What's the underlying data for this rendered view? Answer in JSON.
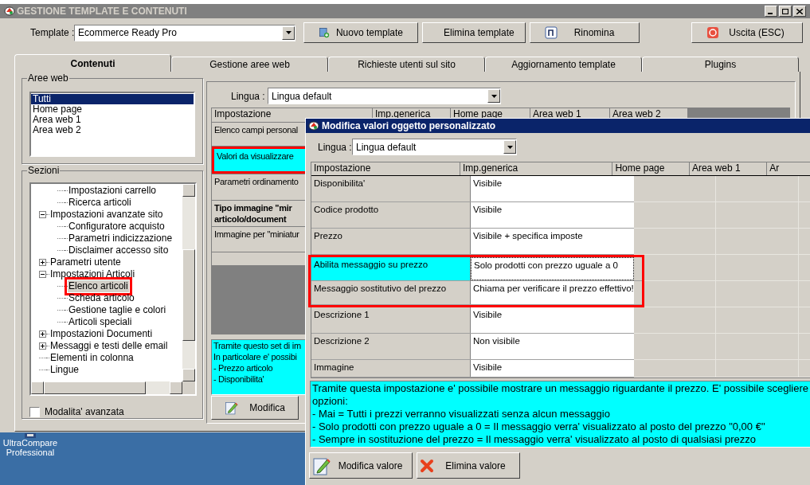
{
  "window": {
    "title": "GESTIONE TEMPLATE E CONTENUTI"
  },
  "template": {
    "label": "Template :",
    "value": "Ecommerce Ready Pro"
  },
  "toolbar": [
    {
      "kind": "new",
      "label": "Nuovo template"
    },
    {
      "kind": "delete",
      "label": "Elimina template"
    },
    {
      "kind": "rename",
      "label": "Rinomina"
    },
    {
      "kind": "exit",
      "label": "Uscita (ESC)"
    }
  ],
  "tabs": [
    {
      "label": "Contenuti",
      "selected": true
    },
    {
      "label": "Gestione aree web",
      "selected": false
    },
    {
      "label": "Richieste utenti sul sito",
      "selected": false
    },
    {
      "label": "Aggiornamento template",
      "selected": false
    },
    {
      "label": "Plugins",
      "selected": false
    }
  ],
  "aree_web": {
    "title": "Aree web",
    "items": [
      {
        "label": "Tutti",
        "selected": true
      },
      {
        "label": "Home page",
        "selected": false
      },
      {
        "label": "Area web 1",
        "selected": false
      },
      {
        "label": "Area web 2",
        "selected": false
      }
    ]
  },
  "sezioni": {
    "title": "Sezioni",
    "orphan_items": [
      {
        "label": "Impostazioni carrello",
        "selected": false,
        "highlighted": false
      },
      {
        "label": "Ricerca articoli",
        "selected": false,
        "highlighted": false
      }
    ],
    "items": [
      {
        "label": "Impostazioni avanzate sito",
        "expanded": true,
        "selected": false,
        "highlighted": false,
        "children": [
          {
            "label": "Configuratore acquisto",
            "selected": false,
            "highlighted": false
          },
          {
            "label": "Parametri indicizzazione",
            "selected": false,
            "highlighted": false
          },
          {
            "label": "Disclaimer accesso sito",
            "selected": false,
            "highlighted": false
          }
        ]
      },
      {
        "label": "Parametri utente",
        "expanded": false,
        "selected": false,
        "highlighted": false
      },
      {
        "label": "Impostazioni Articoli",
        "expanded": true,
        "selected": false,
        "highlighted": false,
        "children": [
          {
            "label": "Elenco articoli",
            "selected": true,
            "highlighted": true
          },
          {
            "label": "Scheda articolo",
            "selected": false,
            "highlighted": false
          },
          {
            "label": "Gestione taglie e colori",
            "selected": false,
            "highlighted": false
          },
          {
            "label": "Articoli speciali",
            "selected": false,
            "highlighted": false
          }
        ]
      },
      {
        "label": "Impostazioni Documenti",
        "expanded": false,
        "selected": false,
        "highlighted": false
      },
      {
        "label": "Messaggi e testi delle email",
        "expanded": false,
        "selected": false,
        "highlighted": false
      },
      {
        "label": "Elementi in colonna",
        "selected": false,
        "highlighted": false
      },
      {
        "label": "Lingue",
        "selected": false,
        "highlighted": false
      }
    ]
  },
  "advanced": {
    "label": "Modalita' avanzata",
    "checked": false
  },
  "content": {
    "language": {
      "label": "Lingua :",
      "value": "Lingua default"
    },
    "columns": [
      "Impostazione",
      "Imp.generica",
      "Home page",
      "Area web 1",
      "Area web 2"
    ],
    "rows": [
      {
        "label": "Elenco campi personal",
        "selected": false,
        "highlighted": false,
        "bold": false
      },
      {
        "label": "Valori da visualizzare",
        "selected": true,
        "highlighted": true,
        "bold": false
      },
      {
        "label": "Parametri ordinamento",
        "selected": false,
        "highlighted": false,
        "bold": false
      },
      {
        "label": "Tipo immagine \"mir\narticolo/document",
        "selected": false,
        "highlighted": false,
        "bold": true
      },
      {
        "label": "Immagine per \"miniatur",
        "selected": false,
        "highlighted": false,
        "bold": false
      }
    ],
    "description": [
      "Tramite questo set di im",
      "In particolare e' possibi",
      "- Prezzo articolo",
      "- Disponibilita'"
    ],
    "button": "Modifica"
  },
  "dialog": {
    "title": "Modifica valori oggetto personalizzato",
    "language": {
      "label": "Lingua :",
      "value": "Lingua default"
    },
    "columns": [
      "Impostazione",
      "Imp.generica",
      "Home page",
      "Area web 1",
      "Ar"
    ],
    "rows": [
      {
        "label": "Disponibilita'",
        "value": "Visibile",
        "selected": false,
        "highlighted": false
      },
      {
        "label": "Codice prodotto",
        "value": "Visibile",
        "selected": false,
        "highlighted": false
      },
      {
        "label": "Prezzo",
        "value": "Visibile + specifica imposte",
        "selected": false,
        "highlighted": false
      },
      {
        "label": "Abilita messaggio su prezzo",
        "value": "Solo prodotti con prezzo uguale a 0",
        "selected": true,
        "highlighted": true
      },
      {
        "label": "Messaggio sostitutivo del prezzo",
        "value": "Chiama per verificare il prezzo effettivo!",
        "selected": false,
        "highlighted": true
      },
      {
        "label": "Descrizione 1",
        "value": "Visibile",
        "selected": false,
        "highlighted": false
      },
      {
        "label": "Descrizione 2",
        "value": "Non visibile",
        "selected": false,
        "highlighted": false
      },
      {
        "label": "Immagine",
        "value": "Visibile",
        "selected": false,
        "highlighted": false
      }
    ],
    "description": [
      "Tramite questa impostazione e' possibile mostrare un messaggio riguardante il prezzo. E' possibile scegliere",
      "opzioni:",
      "- Mai = Tutti i prezzi verranno visualizzati senza alcun messaggio",
      "- Solo prodotti con prezzo uguale a 0 = Il messaggio verra' visualizzato al posto del prezzo \"0,00 €\"",
      "- Sempre in sostituzione del prezzo = Il messaggio verra' visualizzato al posto di qualsiasi prezzo"
    ],
    "buttons": [
      {
        "kind": "edit",
        "label": "Modifica valore"
      },
      {
        "kind": "delete",
        "label": "Elimina valore"
      }
    ]
  },
  "desktop_icons": [
    {
      "label": "UltraCompare Professional"
    }
  ]
}
